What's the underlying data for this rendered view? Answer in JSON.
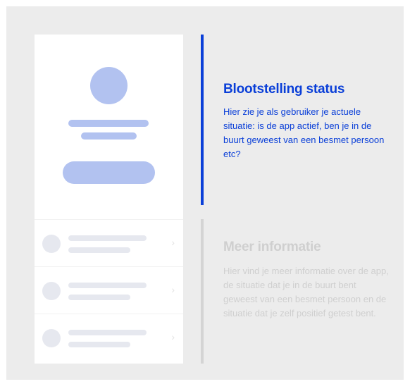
{
  "sections": [
    {
      "title": "Blootstelling status",
      "text": "Hier zie je als gebruiker je actuele situatie: is de app actief, ben je in de buurt geweest van een besmet persoon etc?",
      "state": "active",
      "color": "#0a3fd8"
    },
    {
      "title": "Meer informatie",
      "text": "Hier vind je meer informatie over de app, de situatie dat je in de buurt bent geweest van een besmet persoon en de situatie dat je zelf positief getest bent.",
      "state": "inactive",
      "color": "#cfcfcf"
    }
  ],
  "colors": {
    "background": "#ececec",
    "placeholder_active": "#b2c2f0",
    "placeholder_inactive": "#e6e8ef",
    "divider_active": "#0a3fd8",
    "divider_inactive": "#d4d4d4"
  },
  "wireframe": {
    "list_rows": 3,
    "chevron": "›"
  }
}
